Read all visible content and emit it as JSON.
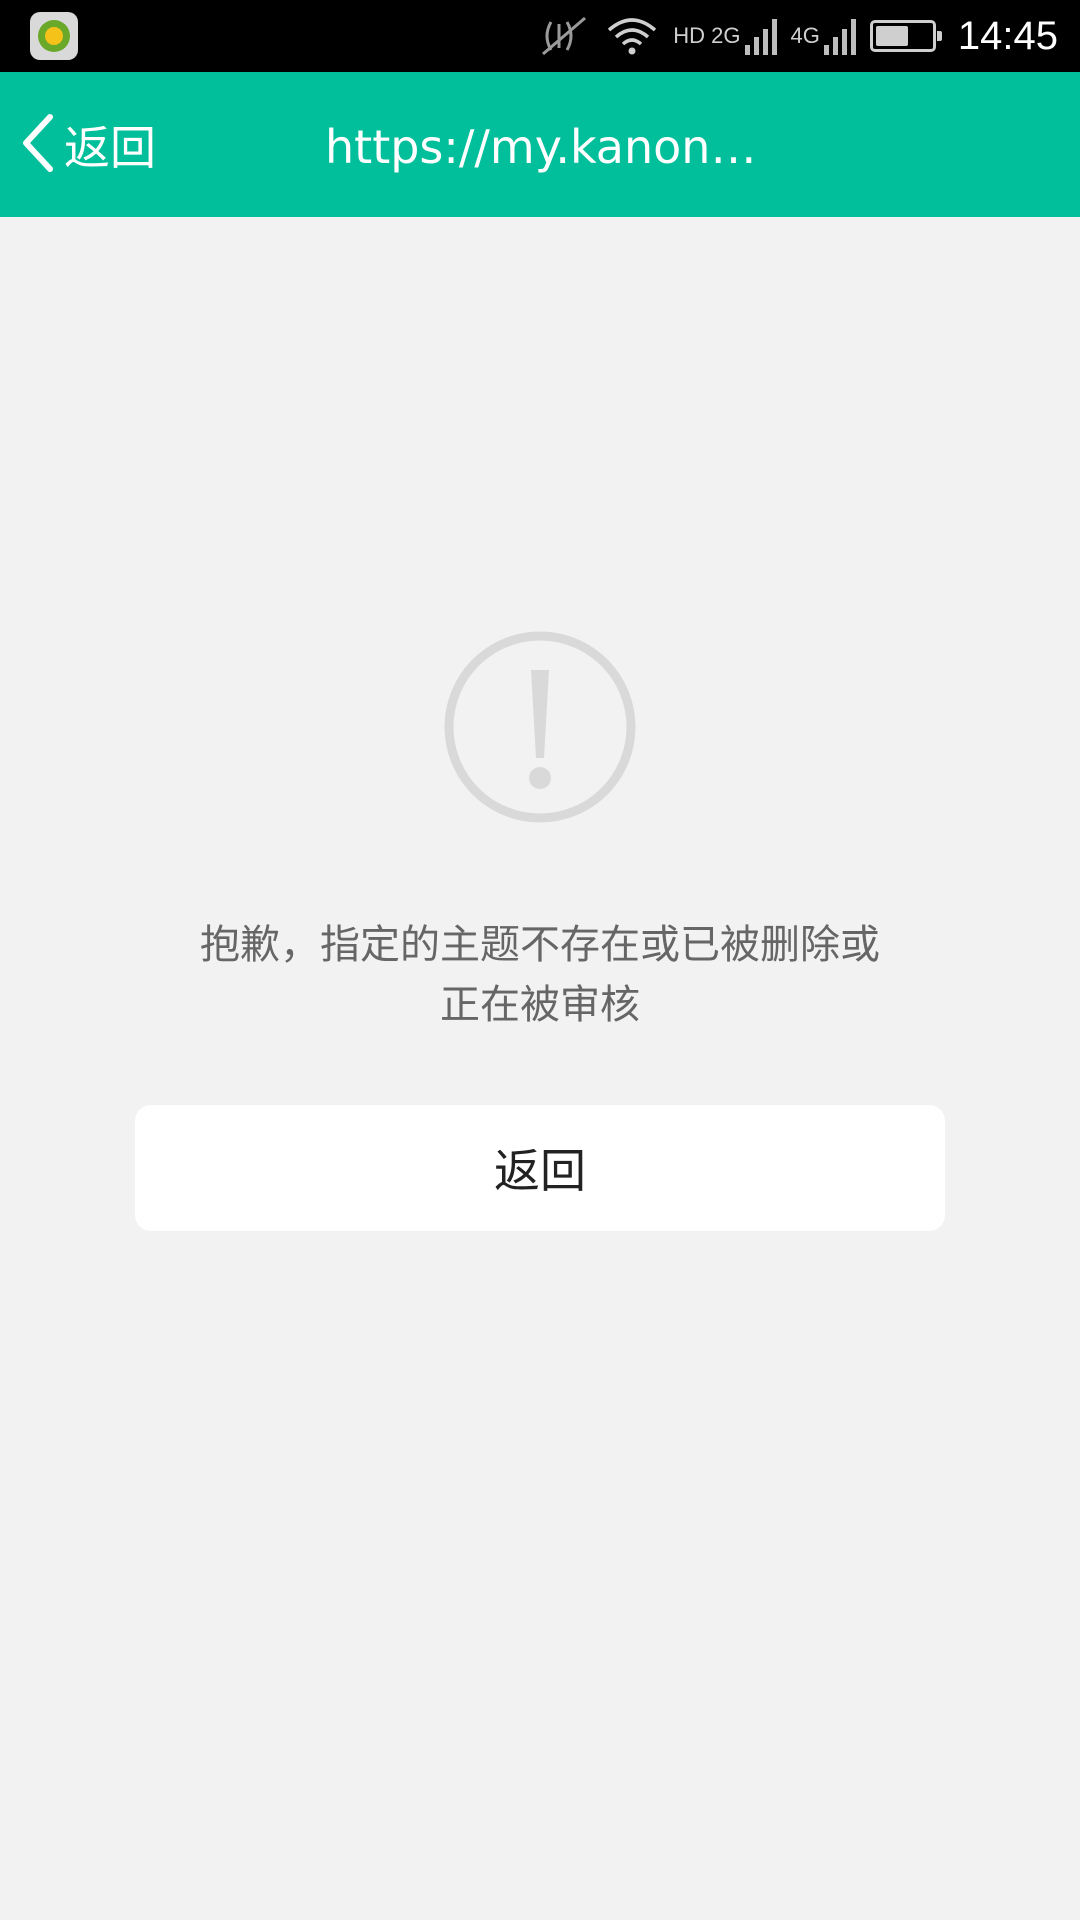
{
  "status_bar": {
    "app_icon": "360-security-icon",
    "icons": [
      "mute-vibrate-icon",
      "wifi-icon",
      "cellular-signal-icon",
      "battery-icon"
    ],
    "network_1": "HD 2G",
    "network_2": "4G",
    "battery_level": 0.6,
    "time": "14:45"
  },
  "nav": {
    "back_label": "返回",
    "title": "https://my.kanon…",
    "background_color": "#00bf9a"
  },
  "content": {
    "icon": "exclamation-circle-icon",
    "message_line1": "抱歉，指定的主题不存在或已被删除或",
    "message_line2": "正在被审核",
    "return_button_label": "返回"
  }
}
